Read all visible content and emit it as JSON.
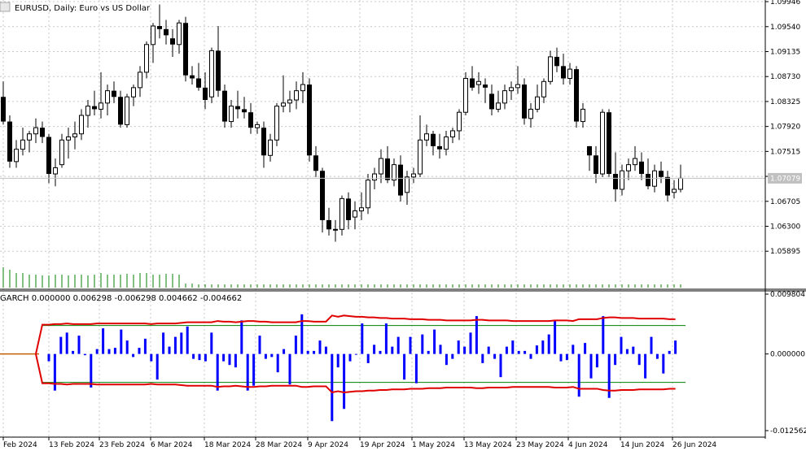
{
  "main_title": "EURUSD, Daily:  Euro vs US Dollar",
  "indicator_title": "GARCH 0.000000 0.006298 -0.006298 0.004662 -0.004662",
  "current_price_label": "1.07079",
  "current_price": 1.07079,
  "colors": {
    "bull": "#000000",
    "bear": "#000000",
    "grid": "#c8c8c8",
    "volume": "#008000",
    "histogram": "#0000ff",
    "garch_band": "#e00000",
    "level_line": "#008000",
    "flat_line": "#c06000",
    "price_tag": "#c0c0c0"
  },
  "chart_data": [
    {
      "type": "candlestick",
      "symbol": "EURUSD",
      "timeframe": "Daily",
      "description": "Euro vs US Dollar",
      "ylim": [
        1.057,
        1.09946
      ],
      "y_ticks": [
        {
          "value": 1.09946,
          "label": "1.09946"
        },
        {
          "value": 1.0954,
          "label": "1.09540"
        },
        {
          "value": 1.09135,
          "label": "1.09135"
        },
        {
          "value": 1.0873,
          "label": "1.08730"
        },
        {
          "value": 1.08325,
          "label": "1.08325"
        },
        {
          "value": 1.0792,
          "label": "1.07920"
        },
        {
          "value": 1.07515,
          "label": "1.07515"
        },
        {
          "value": 1.0711,
          "label": ""
        },
        {
          "value": 1.06705,
          "label": "1.06705"
        },
        {
          "value": 1.063,
          "label": "1.06300"
        },
        {
          "value": 1.05895,
          "label": "1.05895"
        }
      ],
      "grid": true,
      "x_ticks": [
        "Feb 2024",
        "13 Feb 2024",
        "23 Feb 2024",
        "6 Mar 2024",
        "18 Mar 2024",
        "28 Mar 2024",
        "9 Apr 2024",
        "19 Apr 2024",
        "1 May 2024",
        "13 May 2024",
        "23 May 2024",
        "4 Jun 2024",
        "14 Jun 2024",
        "26 Jun 2024"
      ],
      "candles": [
        [
          1.084,
          1.0865,
          1.0795,
          1.08
        ],
        [
          1.08,
          1.081,
          1.0725,
          1.0735
        ],
        [
          1.0735,
          1.077,
          1.0725,
          1.0755
        ],
        [
          1.0755,
          1.079,
          1.0745,
          1.077
        ],
        [
          1.077,
          1.0785,
          1.075,
          1.078
        ],
        [
          1.078,
          1.0805,
          1.0765,
          1.079
        ],
        [
          1.079,
          1.08,
          1.0765,
          1.0775
        ],
        [
          1.0775,
          1.078,
          1.07,
          1.0715
        ],
        [
          1.0715,
          1.074,
          1.0695,
          1.0725
        ],
        [
          1.073,
          1.078,
          1.0725,
          1.077
        ],
        [
          1.077,
          1.079,
          1.074,
          1.0775
        ],
        [
          1.0775,
          1.08,
          1.0755,
          1.078
        ],
        [
          1.078,
          1.082,
          1.077,
          1.081
        ],
        [
          1.081,
          1.0835,
          1.079,
          1.0825
        ],
        [
          1.0825,
          1.085,
          1.081,
          1.082
        ],
        [
          1.082,
          1.088,
          1.0805,
          1.083
        ],
        [
          1.083,
          1.086,
          1.081,
          1.085
        ],
        [
          1.085,
          1.0865,
          1.083,
          1.084
        ],
        [
          1.084,
          1.085,
          1.079,
          1.0795
        ],
        [
          1.0795,
          1.0845,
          1.079,
          1.084
        ],
        [
          1.084,
          1.086,
          1.0825,
          1.0855
        ],
        [
          1.0855,
          1.089,
          1.084,
          1.088
        ],
        [
          1.088,
          1.093,
          1.087,
          1.0925
        ],
        [
          1.0925,
          1.096,
          1.0895,
          1.0955
        ],
        [
          1.0955,
          1.099,
          1.0935,
          1.095
        ],
        [
          1.095,
          1.0965,
          1.0925,
          1.094
        ],
        [
          1.0935,
          1.095,
          1.0905,
          1.0925
        ],
        [
          1.0925,
          1.0965,
          1.091,
          1.096
        ],
        [
          1.096,
          1.097,
          1.0865,
          1.0875
        ],
        [
          1.0875,
          1.089,
          1.086,
          1.087
        ],
        [
          1.087,
          1.0895,
          1.085,
          1.0855
        ],
        [
          1.0855,
          1.088,
          1.082,
          1.0835
        ],
        [
          1.084,
          1.092,
          1.083,
          1.0915
        ],
        [
          1.0915,
          1.0955,
          1.084,
          1.085
        ],
        [
          1.085,
          1.086,
          1.079,
          1.08
        ],
        [
          1.08,
          1.0835,
          1.079,
          1.0825
        ],
        [
          1.0825,
          1.085,
          1.0805,
          1.082
        ],
        [
          1.082,
          1.084,
          1.0805,
          1.0815
        ],
        [
          1.0815,
          1.083,
          1.078,
          1.079
        ],
        [
          1.079,
          1.08,
          1.078,
          1.0795
        ],
        [
          1.079,
          1.08,
          1.0725,
          1.0745
        ],
        [
          1.0745,
          1.078,
          1.0735,
          1.077
        ],
        [
          1.077,
          1.083,
          1.076,
          1.0825
        ],
        [
          1.0825,
          1.0875,
          1.0815,
          1.083
        ],
        [
          1.083,
          1.085,
          1.0815,
          1.0835
        ],
        [
          1.0835,
          1.0865,
          1.082,
          1.085
        ],
        [
          1.085,
          1.088,
          1.083,
          1.086
        ],
        [
          1.086,
          1.087,
          1.0735,
          1.0745
        ],
        [
          1.0745,
          1.076,
          1.071,
          1.072
        ],
        [
          1.072,
          1.0725,
          1.062,
          1.064
        ],
        [
          1.064,
          1.066,
          1.0615,
          1.0625
        ],
        [
          1.0625,
          1.064,
          1.0605,
          1.0625
        ],
        [
          1.0625,
          1.068,
          1.0615,
          1.0675
        ],
        [
          1.0675,
          1.0685,
          1.0625,
          1.064
        ],
        [
          1.0645,
          1.067,
          1.0625,
          1.0655
        ],
        [
          1.0655,
          1.0685,
          1.064,
          1.066
        ],
        [
          1.066,
          1.0715,
          1.065,
          1.0705
        ],
        [
          1.0705,
          1.0725,
          1.069,
          1.0715
        ],
        [
          1.0715,
          1.0755,
          1.07,
          1.074
        ],
        [
          1.074,
          1.076,
          1.07,
          1.0705
        ],
        [
          1.0705,
          1.074,
          1.0695,
          1.073
        ],
        [
          1.073,
          1.0745,
          1.067,
          1.068
        ],
        [
          1.0685,
          1.072,
          1.0665,
          1.071
        ],
        [
          1.071,
          1.0725,
          1.07,
          1.0715
        ],
        [
          1.0715,
          1.081,
          1.071,
          1.077
        ],
        [
          1.077,
          1.0795,
          1.076,
          1.078
        ],
        [
          1.078,
          1.0785,
          1.0745,
          1.076
        ],
        [
          1.076,
          1.078,
          1.074,
          1.0755
        ],
        [
          1.0755,
          1.0785,
          1.0745,
          1.0775
        ],
        [
          1.0775,
          1.079,
          1.0765,
          1.0785
        ],
        [
          1.0785,
          1.082,
          1.077,
          1.0815
        ],
        [
          1.0815,
          1.088,
          1.081,
          1.087
        ],
        [
          1.087,
          1.089,
          1.085,
          1.0855
        ],
        [
          1.086,
          1.088,
          1.0845,
          1.0865
        ],
        [
          1.086,
          1.087,
          1.083,
          1.0855
        ],
        [
          1.0845,
          1.086,
          1.081,
          1.082
        ],
        [
          1.082,
          1.085,
          1.0815,
          1.083
        ],
        [
          1.083,
          1.086,
          1.082,
          1.085
        ],
        [
          1.085,
          1.0865,
          1.0835,
          1.0855
        ],
        [
          1.0855,
          1.089,
          1.0845,
          1.086
        ],
        [
          1.086,
          1.087,
          1.0795,
          1.0805
        ],
        [
          1.0805,
          1.083,
          1.079,
          1.082
        ],
        [
          1.082,
          1.086,
          1.0815,
          1.084
        ],
        [
          1.084,
          1.087,
          1.083,
          1.0865
        ],
        [
          1.0865,
          1.0915,
          1.086,
          1.0905
        ],
        [
          1.0905,
          1.092,
          1.088,
          1.089
        ],
        [
          1.089,
          1.091,
          1.086,
          1.087
        ],
        [
          1.087,
          1.0895,
          1.086,
          1.0885
        ],
        [
          1.0885,
          1.089,
          1.079,
          1.08
        ],
        [
          1.08,
          1.083,
          1.079,
          1.082
        ],
        [
          1.076,
          1.076,
          1.072,
          1.0745
        ],
        [
          1.0745,
          1.076,
          1.07,
          1.0715
        ],
        [
          1.0715,
          1.082,
          1.071,
          1.0815
        ],
        [
          1.0815,
          1.082,
          1.071,
          1.0715
        ],
        [
          1.0715,
          1.075,
          1.067,
          1.069
        ],
        [
          1.069,
          1.073,
          1.068,
          1.072
        ],
        [
          1.072,
          1.074,
          1.0705,
          1.073
        ],
        [
          1.073,
          1.076,
          1.072,
          1.074
        ],
        [
          1.0735,
          1.075,
          1.0705,
          1.0715
        ],
        [
          1.0715,
          1.074,
          1.069,
          1.0695
        ],
        [
          1.0695,
          1.073,
          1.0685,
          1.072
        ],
        [
          1.072,
          1.0735,
          1.07,
          1.071
        ],
        [
          1.071,
          1.072,
          1.067,
          1.068
        ],
        [
          1.0685,
          1.0705,
          1.0675,
          1.069
        ],
        [
          1.069,
          1.073,
          1.0685,
          1.0708
        ]
      ],
      "volume": [
        25,
        22,
        18,
        18,
        16,
        16,
        15,
        15,
        16,
        16,
        15,
        16,
        16,
        15,
        16,
        18,
        16,
        16,
        16,
        17,
        16,
        18,
        18,
        16,
        16,
        17,
        17,
        16,
        5,
        5,
        4,
        4,
        4,
        4,
        4,
        4,
        4,
        4,
        4,
        4,
        4,
        4,
        4,
        4,
        4,
        4,
        4,
        4,
        4,
        4,
        4,
        4,
        4,
        4,
        4,
        4,
        4,
        4,
        4,
        4,
        4,
        4,
        4,
        4,
        4,
        4,
        4,
        4,
        4,
        4,
        4,
        4,
        4,
        4,
        4,
        4,
        4,
        4,
        4,
        4,
        4,
        4,
        4,
        4,
        4,
        4,
        4,
        4,
        4,
        4,
        4,
        4,
        4,
        4,
        4,
        4,
        4,
        4,
        4,
        4,
        4,
        4,
        4,
        4,
        4
      ]
    },
    {
      "type": "bar",
      "name": "GARCH",
      "ylim": [
        -0.012562,
        0.009804
      ],
      "y_ticks": [
        {
          "value": 0.009804,
          "label": "0.009804"
        },
        {
          "value": 0.0,
          "label": "0.000000"
        },
        {
          "value": -0.012562,
          "label": "-0.012562"
        }
      ],
      "level_lines": [
        0.004662,
        -0.004662
      ],
      "histogram": [
        -0.0012,
        -0.006,
        0.0028,
        0.0035,
        0.0005,
        0.003,
        -0.0002,
        -0.0055,
        0.0008,
        0.0042,
        0.0008,
        0.001,
        0.004,
        0.0022,
        -0.0005,
        0.001,
        0.0025,
        -0.0012,
        -0.0042,
        0.0035,
        0.0012,
        0.0028,
        0.0035,
        0.0045,
        -0.0008,
        -0.001,
        -0.0012,
        0.0035,
        -0.006,
        -0.0012,
        -0.0018,
        -0.0022,
        0.0055,
        -0.006,
        -0.0052,
        0.003,
        -0.0008,
        -0.0005,
        -0.003,
        0.0008,
        -0.005,
        0.003,
        0.0065,
        0.0005,
        0.0005,
        0.0022,
        0.0012,
        -0.011,
        -0.0022,
        -0.009,
        -0.0012,
        0.0,
        0.005,
        -0.0015,
        0.0015,
        0.0005,
        0.005,
        0.0012,
        0.0028,
        -0.0042,
        0.0028,
        -0.0048,
        0.0032,
        0.0005,
        0.004,
        0.0015,
        -0.0018,
        -0.0008,
        0.0022,
        0.0012,
        0.0035,
        0.0062,
        -0.0015,
        0.0012,
        -0.0008,
        -0.0038,
        0.0012,
        0.0022,
        0.0005,
        0.0005,
        -0.0008,
        0.0014,
        0.0022,
        0.0032,
        0.0055,
        -0.0012,
        -0.001,
        0.0015,
        -0.007,
        0.0018,
        -0.004,
        -0.0022,
        0.0062,
        -0.0072,
        -0.0018,
        0.0028,
        0.0008,
        0.0012,
        -0.0018,
        -0.004,
        0.0028,
        -0.0008,
        -0.0032,
        0.0005,
        0.0022
      ],
      "band_upper": [
        0.0048,
        0.0049,
        0.0049,
        0.005,
        0.0049,
        0.0049,
        0.0049,
        0.0049,
        0.005,
        0.005,
        0.005,
        0.005,
        0.005,
        0.005,
        0.005,
        0.005,
        0.005,
        0.0049,
        0.005,
        0.005,
        0.005,
        0.005,
        0.0051,
        0.0052,
        0.0052,
        0.0052,
        0.0052,
        0.0052,
        0.0054,
        0.0053,
        0.0053,
        0.0052,
        0.0053,
        0.0054,
        0.0054,
        0.0053,
        0.0053,
        0.0052,
        0.0052,
        0.0052,
        0.0052,
        0.0052,
        0.0054,
        0.0054,
        0.0053,
        0.0053,
        0.0053,
        0.0063,
        0.0061,
        0.0063,
        0.0062,
        0.0061,
        0.0061,
        0.006,
        0.006,
        0.0059,
        0.0059,
        0.0058,
        0.0058,
        0.0058,
        0.0057,
        0.0057,
        0.0057,
        0.0056,
        0.0056,
        0.0056,
        0.0055,
        0.0055,
        0.0055,
        0.0055,
        0.0055,
        0.0056,
        0.0056,
        0.0055,
        0.0055,
        0.0055,
        0.0055,
        0.0054,
        0.0054,
        0.0054,
        0.0054,
        0.0054,
        0.0054,
        0.0054,
        0.0055,
        0.0055,
        0.0055,
        0.0054,
        0.0057,
        0.0057,
        0.0057,
        0.0057,
        0.0059,
        0.006,
        0.006,
        0.0059,
        0.0059,
        0.0059,
        0.0058,
        0.0058,
        0.0058,
        0.0058,
        0.0058,
        0.0057,
        0.0057
      ],
      "band_lower": [
        -0.0048,
        -0.0049,
        -0.0049,
        -0.005,
        -0.0049,
        -0.0049,
        -0.0049,
        -0.0049,
        -0.005,
        -0.005,
        -0.005,
        -0.005,
        -0.005,
        -0.005,
        -0.005,
        -0.005,
        -0.005,
        -0.0049,
        -0.005,
        -0.005,
        -0.005,
        -0.005,
        -0.0051,
        -0.0052,
        -0.0052,
        -0.0052,
        -0.0052,
        -0.0052,
        -0.0054,
        -0.0053,
        -0.0053,
        -0.0052,
        -0.0053,
        -0.0054,
        -0.0054,
        -0.0053,
        -0.0053,
        -0.0052,
        -0.0052,
        -0.0052,
        -0.0052,
        -0.0052,
        -0.0054,
        -0.0054,
        -0.0053,
        -0.0053,
        -0.0053,
        -0.0063,
        -0.0061,
        -0.0063,
        -0.0062,
        -0.0061,
        -0.0061,
        -0.006,
        -0.006,
        -0.0059,
        -0.0059,
        -0.0058,
        -0.0058,
        -0.0058,
        -0.0057,
        -0.0057,
        -0.0057,
        -0.0056,
        -0.0056,
        -0.0056,
        -0.0055,
        -0.0055,
        -0.0055,
        -0.0055,
        -0.0055,
        -0.0056,
        -0.0056,
        -0.0055,
        -0.0055,
        -0.0055,
        -0.0055,
        -0.0054,
        -0.0054,
        -0.0054,
        -0.0054,
        -0.0054,
        -0.0054,
        -0.0054,
        -0.0055,
        -0.0055,
        -0.0055,
        -0.0054,
        -0.0057,
        -0.0057,
        -0.0057,
        -0.0057,
        -0.0059,
        -0.006,
        -0.006,
        -0.0059,
        -0.0059,
        -0.0059,
        -0.0058,
        -0.0058,
        -0.0058,
        -0.0058,
        -0.0058,
        -0.0057,
        -0.0057
      ]
    }
  ]
}
